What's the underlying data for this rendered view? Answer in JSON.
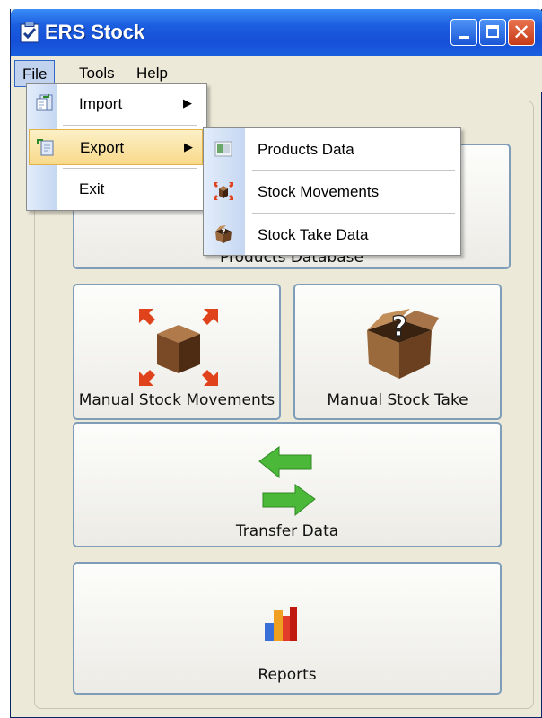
{
  "window": {
    "title": "ERS Stock",
    "controls": {
      "minimize": "",
      "maximize": "",
      "close": "✕"
    }
  },
  "menubar": {
    "items": [
      "File",
      "Tools",
      "Help"
    ]
  },
  "file_menu": {
    "items": [
      {
        "label": "Import",
        "has_submenu": true
      },
      {
        "label": "Export",
        "has_submenu": true,
        "highlighted": true
      },
      {
        "label": "Exit",
        "has_submenu": false
      }
    ],
    "submenu_arrow": "▶"
  },
  "export_submenu": {
    "items": [
      "Products Data",
      "Stock Movements",
      "Stock Take Data"
    ]
  },
  "buttons": {
    "products_database": "Products Database",
    "manual_stock_movements": "Manual Stock Movements",
    "manual_stock_take": "Manual Stock Take",
    "transfer_data": "Transfer Data",
    "reports": "Reports"
  },
  "colors": {
    "titlebar": "#1c5ee0",
    "window_bg": "#ece9d8",
    "button_border": "#7f9db9",
    "menu_highlight": "#f8d98a"
  }
}
